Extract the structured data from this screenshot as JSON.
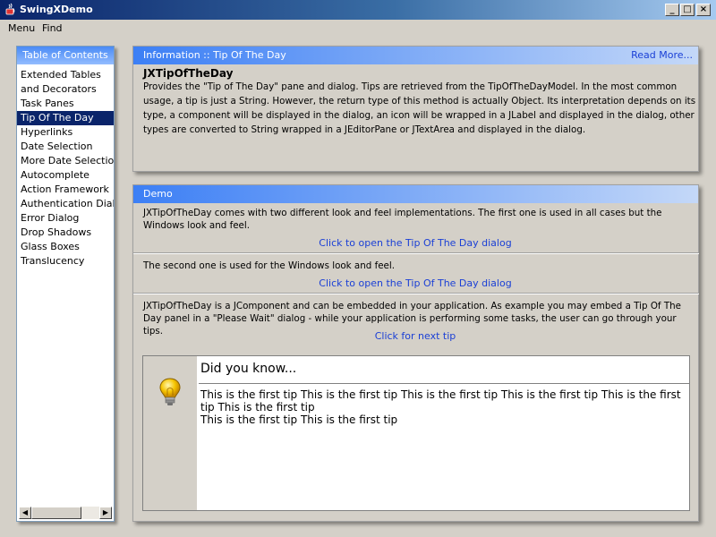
{
  "window": {
    "title": "SwingXDemo",
    "controls": {
      "minimize": "_",
      "maximize": "□",
      "close": "×"
    }
  },
  "menubar": {
    "items": [
      "Menu",
      "Find"
    ]
  },
  "toc": {
    "header": "Table of Contents",
    "items": [
      "Extended Tables and Decorators",
      "Task Panes",
      "Tip Of The Day",
      "Hyperlinks",
      "Date Selection",
      "More Date Selection",
      "Autocomplete",
      "Action Framework",
      "Authentication Dialogs",
      "Error Dialog",
      "Drop Shadows",
      "Glass Boxes",
      "Translucency"
    ],
    "selected_index": 2,
    "scroll_left_glyph": "◀",
    "scroll_right_glyph": "▶"
  },
  "info": {
    "header": "Information :: Tip Of The Day",
    "read_more": "Read More...",
    "title": "JXTipOfTheDay",
    "text": "Provides the \"Tip of The Day\" pane and dialog. Tips are retrieved from the TipOfTheDayModel. In the most common usage, a tip is just a String. However, the return type of this method is actually Object. Its interpretation depends on its type, a component will be displayed in the dialog, an icon will be wrapped in a JLabel and displayed in the dialog, other types are converted to String wrapped in a JEditorPane or JTextArea and displayed in the dialog."
  },
  "demo": {
    "header": "Demo",
    "section1_text": "JXTipOfTheDay comes with two different look and feel implementations. The first one is used in all cases but the Windows look and feel.",
    "section1_link": "Click to open the Tip Of The Day dialog",
    "section2_text": "The second one is used for the Windows look and feel.",
    "section2_link": "Click to open the Tip Of The Day dialog",
    "section3_text": "JXTipOfTheDay is a JComponent and can be embedded in your application. As example you may embed a Tip Of The Day panel in a \"Please Wait\" dialog - while your application is performing some tasks, the user can go through your tips.",
    "section3_link": "Click for next tip",
    "tip": {
      "heading": "Did you know...",
      "icon": "lightbulb-icon",
      "line1": "This is the first tip This is the first tip This is the first tip This is the first tip This is the first tip This is the first tip",
      "line2": "This is the first tip This is the first tip"
    }
  },
  "colors": {
    "header_gradient_start": "#3c7ff5",
    "header_gradient_end": "#c4d8f8",
    "link": "#1a3fd6",
    "selection": "#0a246a",
    "titlebar": "#0a246a"
  }
}
